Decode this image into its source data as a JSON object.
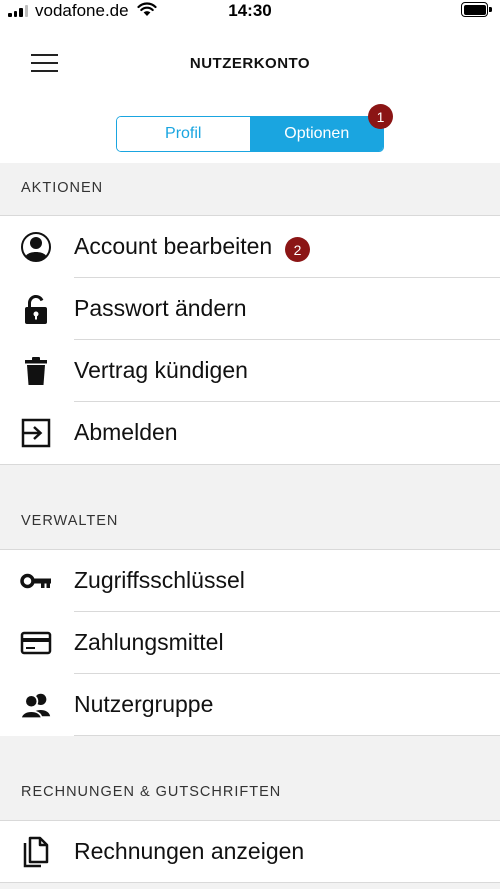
{
  "status_bar": {
    "carrier": "vodafone.de",
    "time": "14:30"
  },
  "header": {
    "title": "NUTZERKONTO"
  },
  "tabs": {
    "items": [
      {
        "label": "Profil",
        "selected": false
      },
      {
        "label": "Optionen",
        "selected": true
      }
    ],
    "badge": "1"
  },
  "sections": [
    {
      "title": "AKTIONEN",
      "items": [
        {
          "label": "Account bearbeiten",
          "icon": "person-circle-icon",
          "badge": "2"
        },
        {
          "label": "Passwort ändern",
          "icon": "lock-icon"
        },
        {
          "label": "Vertrag kündigen",
          "icon": "trash-icon"
        },
        {
          "label": "Abmelden",
          "icon": "logout-icon"
        }
      ]
    },
    {
      "title": "VERWALTEN",
      "items": [
        {
          "label": "Zugriffsschlüssel",
          "icon": "key-icon"
        },
        {
          "label": "Zahlungsmittel",
          "icon": "credit-card-icon"
        },
        {
          "label": "Nutzergruppe",
          "icon": "user-group-icon"
        }
      ]
    },
    {
      "title": "RECHNUNGEN & GUTSCHRIFTEN",
      "items": [
        {
          "label": "Rechnungen anzeigen",
          "icon": "documents-icon"
        }
      ]
    }
  ],
  "colors": {
    "accent": "#1aa5e0",
    "badge": "#8b1515",
    "section_background": "#f2f2f2"
  }
}
